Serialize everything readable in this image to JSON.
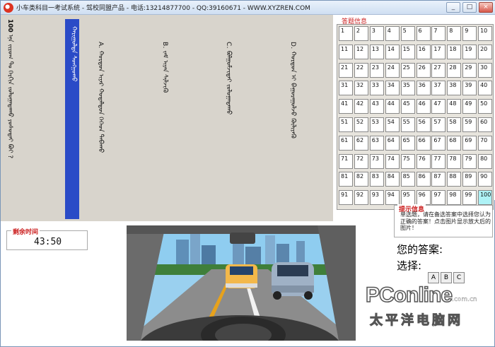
{
  "window": {
    "title": "小车类科目一考试系统 - 驾校同盟产品 - 电话:13214877700 - QQ:39160671 - WWW.XYZREN.COM",
    "min": "_",
    "max": "□",
    "close": "×"
  },
  "question": {
    "number": "100",
    "text": "ᠡᠨᠡ ᠵᠢᠷᠤᠭ ᠲᠤ ᠬᠡᠷᠬᠢᠨ ᠵᠤᠯᠤᠭᠠᠳᠠᠬᠤ ᠶᠤᠰᠤᠲᠠᠢ ᠪᠤᠢ ?",
    "highlight": "ᠬᠠᠷᠢᠭᠤᠯᠲᠠ ᠰᠤᠩᠭᠤᠬᠤ",
    "options": [
      "A. ᠬᠤᠷᠳᠤᠨ ᠢᠶᠡᠷ ᠬᠤᠳᠠᠯᠳᠤᠨ ᠬᠡᠭᠡᠳ ᠳᠠᠪᠠᠬᠤ",
      "B. ᠵᠠᠮ ᠢᠶᠠᠨ ᠰᠢᠯᠵᠢᠬᠦ",
      "C. ᠪᠤᠯᠭᠤᠮᠵᠢᠲᠠᠢ ᠵᠤᠯᠤᠭᠠᠳᠠᠬᠤ",
      "D. ᠬᠤᠷᠳᠤᠨ ᠢ ᠪᠠᠭᠤᠷᠠᠭᠤᠯᠵᠤ ᠬᠦᠯᠢᠶᠡᠬᠦ"
    ]
  },
  "answers": {
    "title": "答题信息",
    "cells": [
      "1",
      "2",
      "3",
      "4",
      "5",
      "6",
      "7",
      "8",
      "9",
      "10",
      "11",
      "12",
      "13",
      "14",
      "15",
      "16",
      "17",
      "18",
      "19",
      "20",
      "21",
      "22",
      "23",
      "24",
      "25",
      "26",
      "27",
      "28",
      "29",
      "30",
      "31",
      "32",
      "33",
      "34",
      "35",
      "36",
      "37",
      "38",
      "39",
      "40",
      "41",
      "42",
      "43",
      "44",
      "45",
      "46",
      "47",
      "48",
      "49",
      "50",
      "51",
      "52",
      "53",
      "54",
      "55",
      "56",
      "57",
      "58",
      "59",
      "60",
      "61",
      "62",
      "63",
      "64",
      "65",
      "66",
      "67",
      "68",
      "69",
      "70",
      "71",
      "72",
      "73",
      "74",
      "75",
      "76",
      "77",
      "78",
      "79",
      "80",
      "81",
      "82",
      "83",
      "84",
      "85",
      "86",
      "87",
      "88",
      "89",
      "90",
      "91",
      "92",
      "93",
      "94",
      "95",
      "96",
      "97",
      "98",
      "99",
      "100"
    ],
    "current": "100"
  },
  "hint": {
    "title": "提示信息",
    "text": "单选题，请在备选答案中选择您认为正确的答案！点击图片显示放大后的图片！"
  },
  "your_answer_label": "您的答案:",
  "choose_label": "选择:",
  "choices": [
    "A",
    "B",
    "C"
  ],
  "timer": {
    "label": "剩余时间",
    "value": "43:50"
  },
  "watermark": {
    "brand": "PConline",
    "domain": ".com.cn",
    "cn": "太平洋电脑网"
  },
  "colors": {
    "highlight": "#2a4bc7",
    "current_cell": "#aef2f6",
    "label_red": "#cc2222"
  }
}
